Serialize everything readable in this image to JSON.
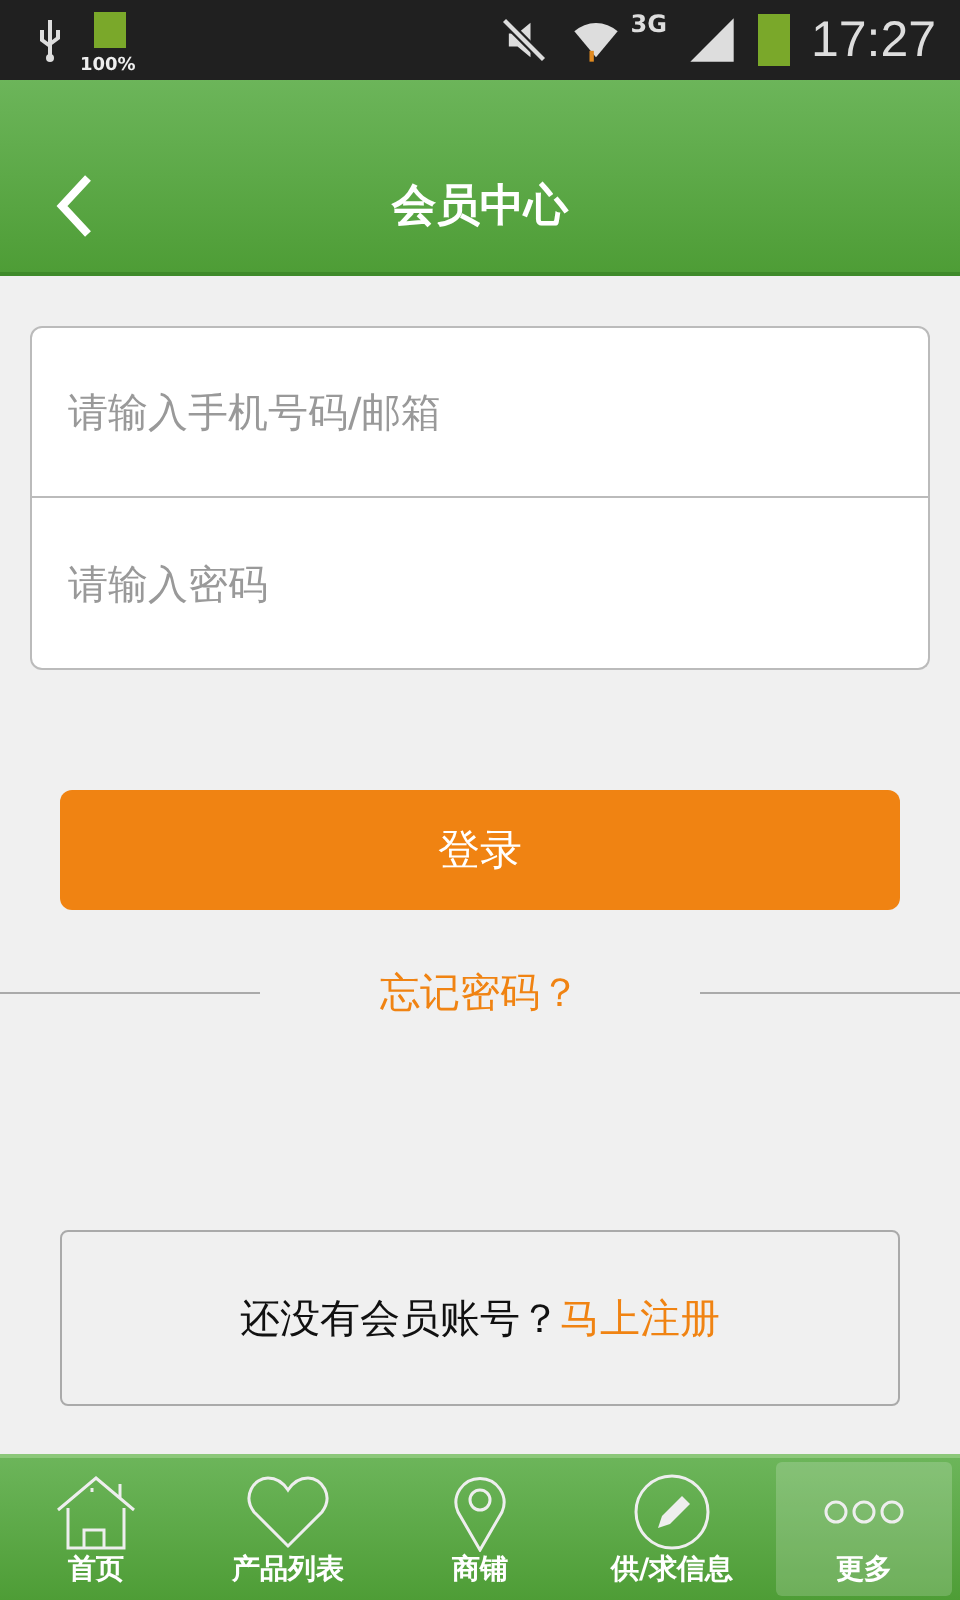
{
  "status_bar": {
    "battery_text": "100%",
    "network": "3G",
    "time": "17:27"
  },
  "header": {
    "title": "会员中心"
  },
  "form": {
    "fields": [
      {
        "placeholder": "请输入手机号码/邮箱"
      },
      {
        "placeholder": "请输入密码"
      }
    ]
  },
  "login_button": "登录",
  "forgot_password": "忘记密码？",
  "register": {
    "text": "还没有会员账号？",
    "link": "马上注册"
  },
  "tabs": [
    {
      "label": "首页",
      "kind": "home",
      "selected": false
    },
    {
      "label": "产品列表",
      "kind": "heart",
      "selected": false
    },
    {
      "label": "商铺",
      "kind": "pin",
      "selected": false
    },
    {
      "label": "供/求信息",
      "kind": "pencil",
      "selected": false
    },
    {
      "label": "更多",
      "kind": "more",
      "selected": true
    }
  ]
}
